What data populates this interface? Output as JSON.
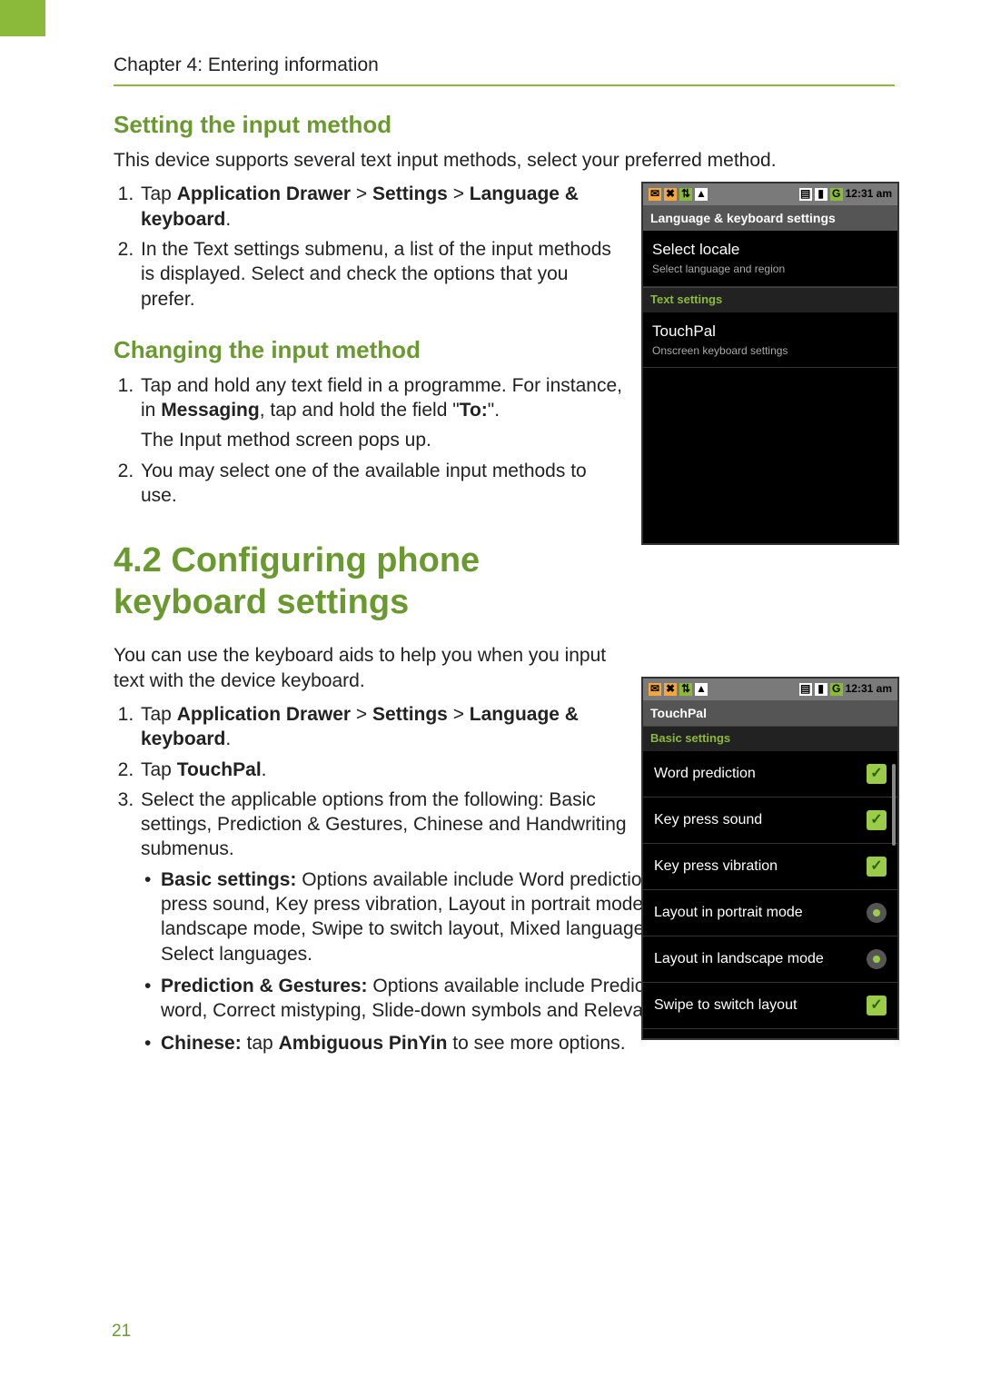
{
  "page_number": "21",
  "chapter_line": "Chapter 4: Entering information",
  "section_a": {
    "heading": "Setting the input method",
    "intro": "This device supports several text input methods, select your preferred method.",
    "steps_setting": {
      "s1_pre": "Tap ",
      "s1_b1": "Application Drawer",
      "s1_gt1": " > ",
      "s1_b2": "Settings",
      "s1_gt2": " > ",
      "s1_b3": "Language & keyboard",
      "s1_post": ".",
      "s2": "In the Text settings submenu, a list of the input methods is displayed. Select and check the options that you prefer."
    }
  },
  "section_b": {
    "heading": "Changing the input method",
    "steps": {
      "s1_l1_pre": "Tap and hold any text field in a programme. For instance, in ",
      "s1_l1_b1": "Messaging",
      "s1_l1_mid": ", tap and hold the field \"",
      "s1_l1_b2": "To:",
      "s1_l1_post": "\".",
      "s1_l2": "The Input method screen pops up.",
      "s2": "You may select one of the available input methods to use."
    }
  },
  "section_c": {
    "heading": "4.2 Configuring phone keyboard settings",
    "intro": "You can use the keyboard aids to help you when you input text with the device keyboard.",
    "steps": {
      "s1_pre": "Tap ",
      "s1_b1": "Application Drawer",
      "s1_gt1": " > ",
      "s1_b2": "Settings",
      "s1_gt2": " > ",
      "s1_b3": "Language & keyboard",
      "s1_post": ".",
      "s2_pre": "Tap ",
      "s2_b": "TouchPal",
      "s2_post": ".",
      "s3": "Select the applicable options from the following: Basic settings, Prediction & Gestures, Chinese and Handwriting submenus.",
      "bullets": {
        "b1_label": "Basic settings:",
        "b1_text": " Options available include Word prediction, Key press sound, Key press vibration, Layout in portrait mode, Layout in landscape mode, Swipe to switch layout, Mixed language input and Select languages.",
        "b2_label": "Prediction & Gestures:",
        "b2_text": " Options available include Predict next word, Correct mistyping, Slide-down symbols and Relevant words.",
        "b3_label": "Chinese:",
        "b3_mid": " tap ",
        "b3_b": "Ambiguous PinYin",
        "b3_post": " to see more options."
      }
    }
  },
  "phone1": {
    "time": "12:31 am",
    "title": "Language & keyboard settings",
    "item1_title": "Select locale",
    "item1_sub": "Select language and region",
    "section1": "Text settings",
    "item2_title": "TouchPal",
    "item2_sub": "Onscreen keyboard settings"
  },
  "phone2": {
    "time": "12:31 am",
    "title": "TouchPal",
    "section": "Basic settings",
    "rows": [
      {
        "label": "Word prediction",
        "control": "check"
      },
      {
        "label": "Key press sound",
        "control": "check"
      },
      {
        "label": "Key press vibration",
        "control": "check"
      },
      {
        "label": "Layout in portrait mode",
        "control": "radio"
      },
      {
        "label": "Layout in landscape mode",
        "control": "radio"
      },
      {
        "label": "Swipe to switch layout",
        "control": "check"
      }
    ]
  },
  "icons": {
    "i1": "✉",
    "i2": "✖",
    "i3": "⇅",
    "i4": "▲",
    "r1": "▤",
    "r2": "▮",
    "r3": "G"
  }
}
